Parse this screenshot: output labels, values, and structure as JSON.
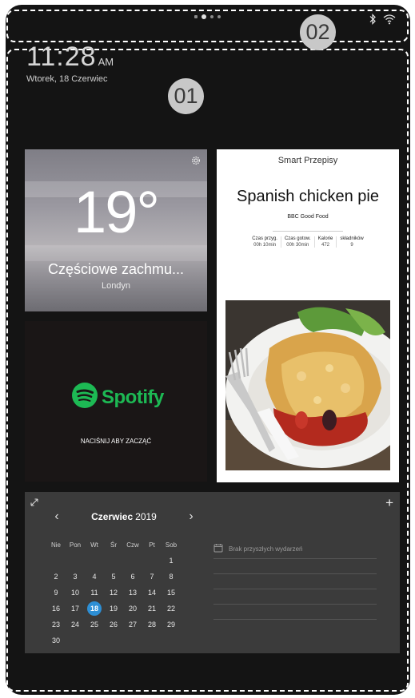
{
  "status_bar": {
    "callout": "02",
    "page_dots": [
      {
        "active": false,
        "shape": "square"
      },
      {
        "active": true,
        "shape": "round"
      },
      {
        "active": false,
        "shape": "round"
      },
      {
        "active": false,
        "shape": "round"
      }
    ],
    "icons": [
      "bluetooth-icon",
      "wifi-icon"
    ]
  },
  "home": {
    "callout": "01",
    "time": "11:28",
    "ampm": "AM",
    "date": "Wtorek, 18 Czerwiec"
  },
  "weather": {
    "temperature": "19°",
    "condition": "Częściowe zachmu...",
    "city": "Londyn",
    "settings_icon": "gear-icon"
  },
  "spotify": {
    "brand": "Spotify",
    "prompt": "NACIŚNIJ ABY ZACZĄĆ"
  },
  "recipe": {
    "header": "Smart Przepisy",
    "title": "Spanish chicken pie",
    "source": "BBC Good Food",
    "stats": [
      {
        "label": "Czas przyg.",
        "value": "00h 10min"
      },
      {
        "label": "Czas gotow.",
        "value": "00h 30min"
      },
      {
        "label": "Kalorie",
        "value": "472"
      },
      {
        "label": "składników",
        "value": "9"
      }
    ]
  },
  "calendar": {
    "month": "Czerwiec",
    "year": "2019",
    "weekdays": [
      "Nie",
      "Pon",
      "Wt",
      "Śr",
      "Czw",
      "Pt",
      "Sob"
    ],
    "weeks": [
      [
        "",
        "",
        "",
        "",
        "",
        "",
        "1"
      ],
      [
        "2",
        "3",
        "4",
        "5",
        "6",
        "7",
        "8"
      ],
      [
        "9",
        "10",
        "11",
        "12",
        "13",
        "14",
        "15"
      ],
      [
        "16",
        "17",
        "18",
        "19",
        "20",
        "21",
        "22"
      ],
      [
        "23",
        "24",
        "25",
        "26",
        "27",
        "28",
        "29"
      ],
      [
        "30",
        "",
        "",
        "",
        "",
        "",
        ""
      ]
    ],
    "today": "18",
    "no_events": "Brak przyszłych wydarzeń",
    "accent_color": "#2d8fd5"
  }
}
